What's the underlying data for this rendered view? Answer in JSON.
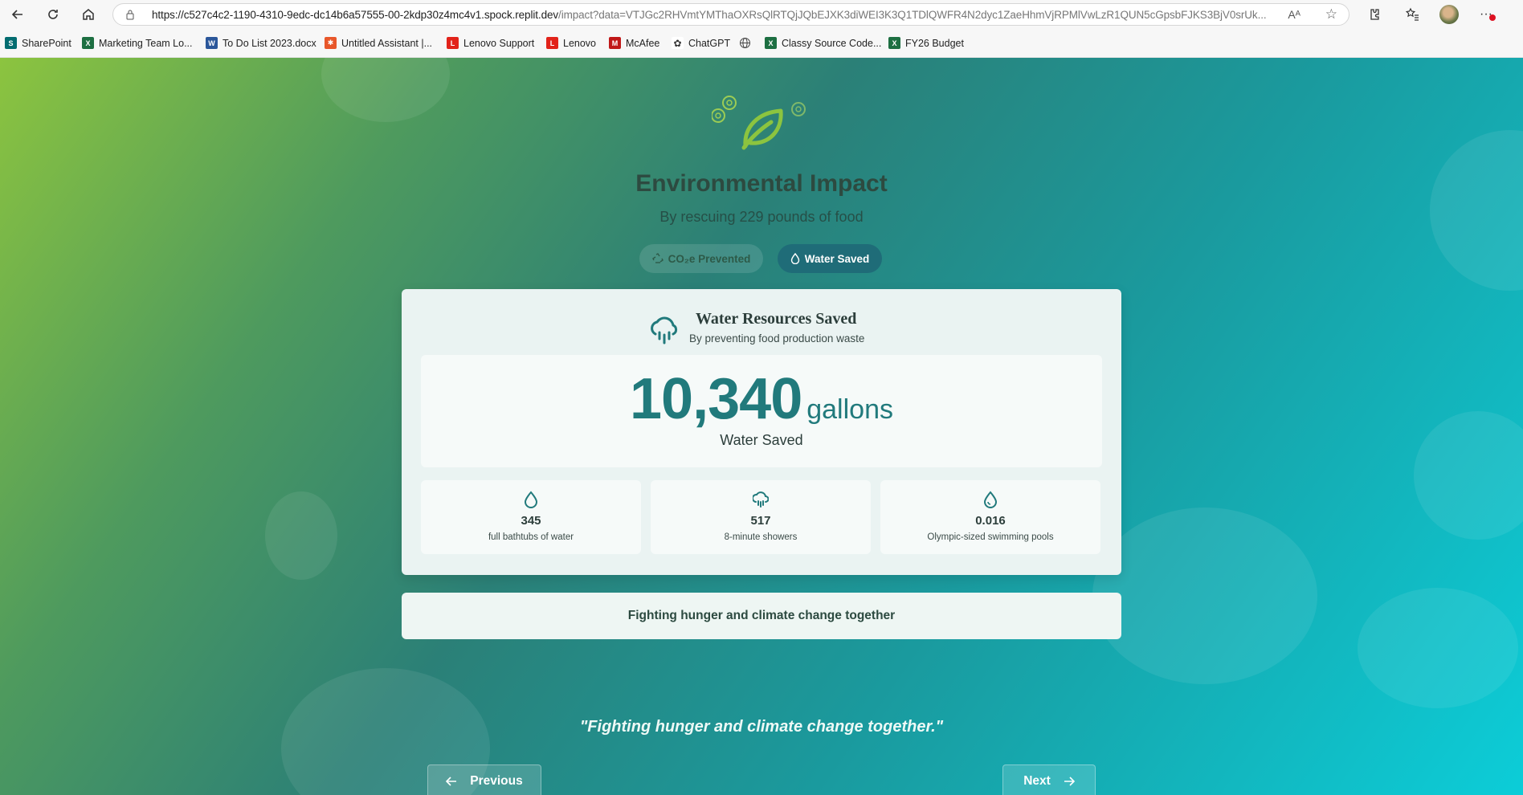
{
  "browser": {
    "url_main": "https://c527c4c2-1190-4310-9edc-dc14b6a57555-00-2kdp30z4mc4v1.spock.replit.dev",
    "url_rest": "/impact?data=VTJGc2RHVmtYMThaOXRsQlRTQjJQbEJXK3diWEI3K3Q1TDlQWFR4N2dyc1ZaeHhmVjRPMlVwLzR1QUN5cGpsbFJKS3BjV0srUk...",
    "read_aloud": "Aᴬ",
    "bookmarks": [
      {
        "label": "SharePoint",
        "icon": "sharepoint-icon",
        "color": "#036c70",
        "glyph": "S"
      },
      {
        "label": "Marketing Team Lo...",
        "icon": "excel-icon",
        "color": "#1d6f42",
        "glyph": "X"
      },
      {
        "label": "To Do List 2023.docx",
        "icon": "word-icon",
        "color": "#2b579a",
        "glyph": "W"
      },
      {
        "label": "Untitled Assistant |...",
        "icon": "assistant-icon",
        "color": "#e8572a",
        "glyph": "✱"
      },
      {
        "label": "Lenovo Support",
        "icon": "lenovo-icon",
        "color": "#e2231a",
        "glyph": "L"
      },
      {
        "label": "Lenovo",
        "icon": "lenovo-icon",
        "color": "#e2231a",
        "glyph": "L"
      },
      {
        "label": "McAfee",
        "icon": "mcafee-icon",
        "color": "#c01818",
        "glyph": "M"
      },
      {
        "label": "ChatGPT",
        "icon": "chatgpt-icon",
        "color": "#333333",
        "glyph": "⚙"
      },
      {
        "label": "",
        "icon": "globe-icon",
        "color": "#555555",
        "glyph": "🌐"
      },
      {
        "label": "Classy Source Code...",
        "icon": "excel-icon",
        "color": "#1d6f42",
        "glyph": "X"
      },
      {
        "label": "FY26 Budget",
        "icon": "excel-icon",
        "color": "#1d6f42",
        "glyph": "X"
      }
    ]
  },
  "page": {
    "title": "Environmental Impact",
    "subtitle": "By rescuing 229 pounds of food",
    "tabs": {
      "co2": "CO₂e Prevented",
      "water": "Water Saved",
      "active": "water"
    },
    "card": {
      "title": "Water Resources Saved",
      "subtitle": "By preventing food production waste",
      "big_value": "10,340",
      "big_unit": "gallons",
      "big_label": "Water Saved",
      "stats": [
        {
          "value": "345",
          "label": "full bathtubs of water",
          "icon": "droplet-icon"
        },
        {
          "value": "517",
          "label": "8-minute showers",
          "icon": "shower-cloud-icon"
        },
        {
          "value": "0.016",
          "label": "Olympic-sized swimming pools",
          "icon": "droplets-icon"
        }
      ]
    },
    "banner": "Fighting hunger and climate change together",
    "quote": "\"Fighting hunger and climate change together.\"",
    "nav": {
      "previous": "Previous",
      "next": "Next"
    },
    "colors": {
      "accent": "#217a7c",
      "active_tab": "#1f6c78",
      "leaf": "#8cc43f"
    }
  }
}
